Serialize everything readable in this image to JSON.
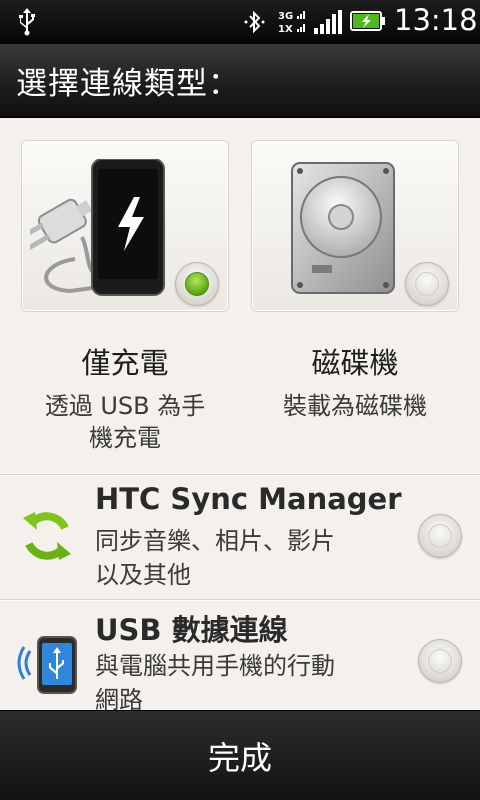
{
  "status_bar": {
    "time": "13:18",
    "network_type": "3G",
    "network_sub": "1X",
    "icons": [
      "usb-icon",
      "bluetooth-icon",
      "network-3g-icon",
      "signal-icon",
      "battery-charging-icon"
    ]
  },
  "header": {
    "title": "選擇連線類型："
  },
  "options": {
    "charge": {
      "title": "僅充電",
      "desc_line1": "透過 USB 為手",
      "desc_line2": "機充電",
      "selected": true
    },
    "disk": {
      "title": "磁碟機",
      "desc_line1": "裝載為磁碟機",
      "selected": false
    }
  },
  "rows": [
    {
      "title": "HTC Sync Manager",
      "desc_line1": "同步音樂、相片、影片",
      "desc_line2": "以及其他",
      "icon": "sync-icon",
      "selected": false
    },
    {
      "title": "USB 數據連線",
      "desc_line1": "與電腦共用手機的行動",
      "desc_line2": "網路",
      "icon": "usb-tethering-icon",
      "selected": false
    }
  ],
  "footer": {
    "done_label": "完成"
  },
  "colors": {
    "accent_green": "#5aa514",
    "sync_green": "#7fc31c",
    "phone_blue": "#2f7fd2"
  }
}
